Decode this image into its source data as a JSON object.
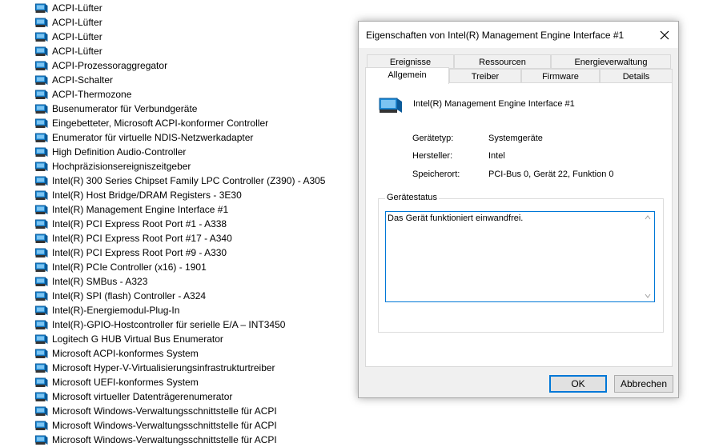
{
  "device_list": [
    "ACPI-Lüfter",
    "ACPI-Lüfter",
    "ACPI-Lüfter",
    "ACPI-Lüfter",
    "ACPI-Prozessoraggregator",
    "ACPI-Schalter",
    "ACPI-Thermozone",
    "Busenumerator für Verbundgeräte",
    "Eingebetteter, Microsoft ACPI-konformer Controller",
    "Enumerator für virtuelle NDIS-Netzwerkadapter",
    "High Definition Audio-Controller",
    "Hochpräzisionsereigniszeitgeber",
    "Intel(R) 300 Series Chipset Family LPC Controller (Z390) - A305",
    "Intel(R) Host Bridge/DRAM Registers - 3E30",
    "Intel(R) Management Engine Interface #1",
    "Intel(R) PCI Express Root Port #1 - A338",
    "Intel(R) PCI Express Root Port #17 - A340",
    "Intel(R) PCI Express Root Port #9 - A330",
    "Intel(R) PCIe Controller (x16) - 1901",
    "Intel(R) SMBus - A323",
    "Intel(R) SPI (flash) Controller - A324",
    "Intel(R)-Energiemodul-Plug-In",
    "Intel(R)-GPIO-Hostcontroller für serielle E/A – INT3450",
    "Logitech G HUB Virtual Bus Enumerator",
    "Microsoft ACPI-konformes System",
    "Microsoft Hyper-V-Virtualisierungsinfrastrukturtreiber",
    "Microsoft UEFI-konformes System",
    "Microsoft virtueller Datenträgerenumerator",
    "Microsoft Windows-Verwaltungsschnittstelle für ACPI",
    "Microsoft Windows-Verwaltungsschnittstelle für ACPI",
    "Microsoft Windows-Verwaltungsschnittstelle für ACPI"
  ],
  "dialog": {
    "title": "Eigenschaften von Intel(R) Management Engine Interface #1",
    "tabs_row1": [
      "Ereignisse",
      "Ressourcen",
      "Energieverwaltung"
    ],
    "tabs_row2": [
      "Allgemein",
      "Treiber",
      "Firmware",
      "Details"
    ],
    "active_tab": "Allgemein",
    "device_name": "Intel(R) Management Engine Interface #1",
    "props": {
      "type_label": "Gerätetyp:",
      "type_value": "Systemgeräte",
      "vendor_label": "Hersteller:",
      "vendor_value": "Intel",
      "location_label": "Speicherort:",
      "location_value": "PCI-Bus 0, Gerät 22, Funktion 0"
    },
    "status_legend": "Gerätestatus",
    "status_text": "Das Gerät funktioniert einwandfrei.",
    "ok_label": "OK",
    "cancel_label": "Abbrechen"
  },
  "colors": {
    "accent": "#0078d7",
    "dialog_bg": "#f0f0f0"
  }
}
